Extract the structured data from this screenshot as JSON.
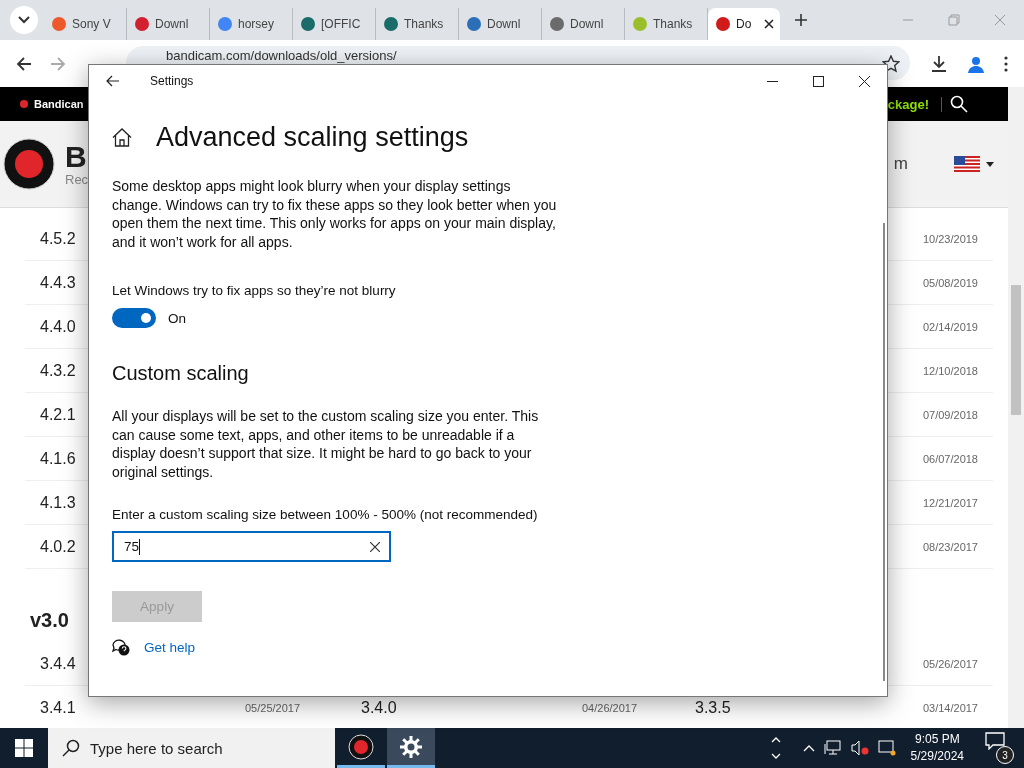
{
  "browser": {
    "tabs": [
      {
        "title": "Sony V",
        "color": "#ec5a2c",
        "selected": false
      },
      {
        "title": "Downl",
        "color": "#d3202f",
        "selected": false
      },
      {
        "title": "horsey",
        "color": "#4285f4",
        "selected": false
      },
      {
        "title": "[OFFIC",
        "color": "#1b6b6b",
        "selected": false
      },
      {
        "title": "Thanks",
        "color": "#1b6b6b",
        "selected": false
      },
      {
        "title": "Downl",
        "color": "#2a6fb8",
        "selected": false
      },
      {
        "title": "Downl",
        "color": "#6b6b6b",
        "selected": false
      },
      {
        "title": "Thanks",
        "color": "#9bbf2a",
        "selected": false
      },
      {
        "title": "Do",
        "color": "#d11a1a",
        "selected": true
      }
    ],
    "url": "bandicam.com/downloads/old_versions/"
  },
  "site": {
    "nav_brand": "Bandican",
    "nav_promo": "ckage!",
    "logo_text": "B",
    "logo_subtext": "Rec",
    "header_text": "m",
    "releases": [
      {
        "kind": "row",
        "version": "4.5.2",
        "date": "10/23/2019"
      },
      {
        "kind": "row",
        "version": "4.4.3",
        "date": "05/08/2019"
      },
      {
        "kind": "row",
        "version": "4.4.0",
        "date": "02/14/2019"
      },
      {
        "kind": "row",
        "version": "4.3.2",
        "date": "12/10/2018"
      },
      {
        "kind": "row",
        "version": "4.2.1",
        "date": "07/09/2018"
      },
      {
        "kind": "row",
        "version": "4.1.6",
        "date": "06/07/2018"
      },
      {
        "kind": "row",
        "version": "4.1.3",
        "date": "12/21/2017"
      },
      {
        "kind": "row",
        "version": "4.0.2",
        "date": "08/23/2017"
      },
      {
        "kind": "heading",
        "label": "v3.0"
      },
      {
        "kind": "row",
        "version": "3.4.4",
        "date": "05/26/2017"
      },
      {
        "kind": "row",
        "version": "3.4.1",
        "date": "03/14/2017",
        "extra": [
          "05/25/2017",
          "3.4.0",
          "04/26/2017",
          "3.3.5"
        ]
      }
    ]
  },
  "dialog": {
    "title": "Settings",
    "heading": "Advanced scaling settings",
    "intro": "Some desktop apps might look blurry when your display settings change. Windows can try to fix these apps so they look better when you open them the next time. This only works for apps on your main display, and it won’t work for all apps.",
    "toggle_label": "Let Windows try to fix apps so they’re not blurry",
    "toggle": {
      "on": true,
      "text": "On"
    },
    "section": "Custom scaling",
    "warning": "All your displays will be set to the custom scaling size you enter. This can cause some text, apps, and other items to be unreadable if a display doesn’t support that size. It might be hard to go back to your original settings.",
    "input_label": "Enter a custom scaling size between 100% - 500% (not recommended)",
    "input_value": "75",
    "apply": {
      "label": "Apply",
      "disabled": true
    },
    "help_link": "Get help"
  },
  "taskbar": {
    "search_placeholder": "Type here to search",
    "apps": [
      {
        "kind": "recorder",
        "selected": false
      },
      {
        "kind": "settings",
        "selected": true
      }
    ],
    "time": "9:05 PM",
    "date": "5/29/2024",
    "notifications": "3"
  }
}
